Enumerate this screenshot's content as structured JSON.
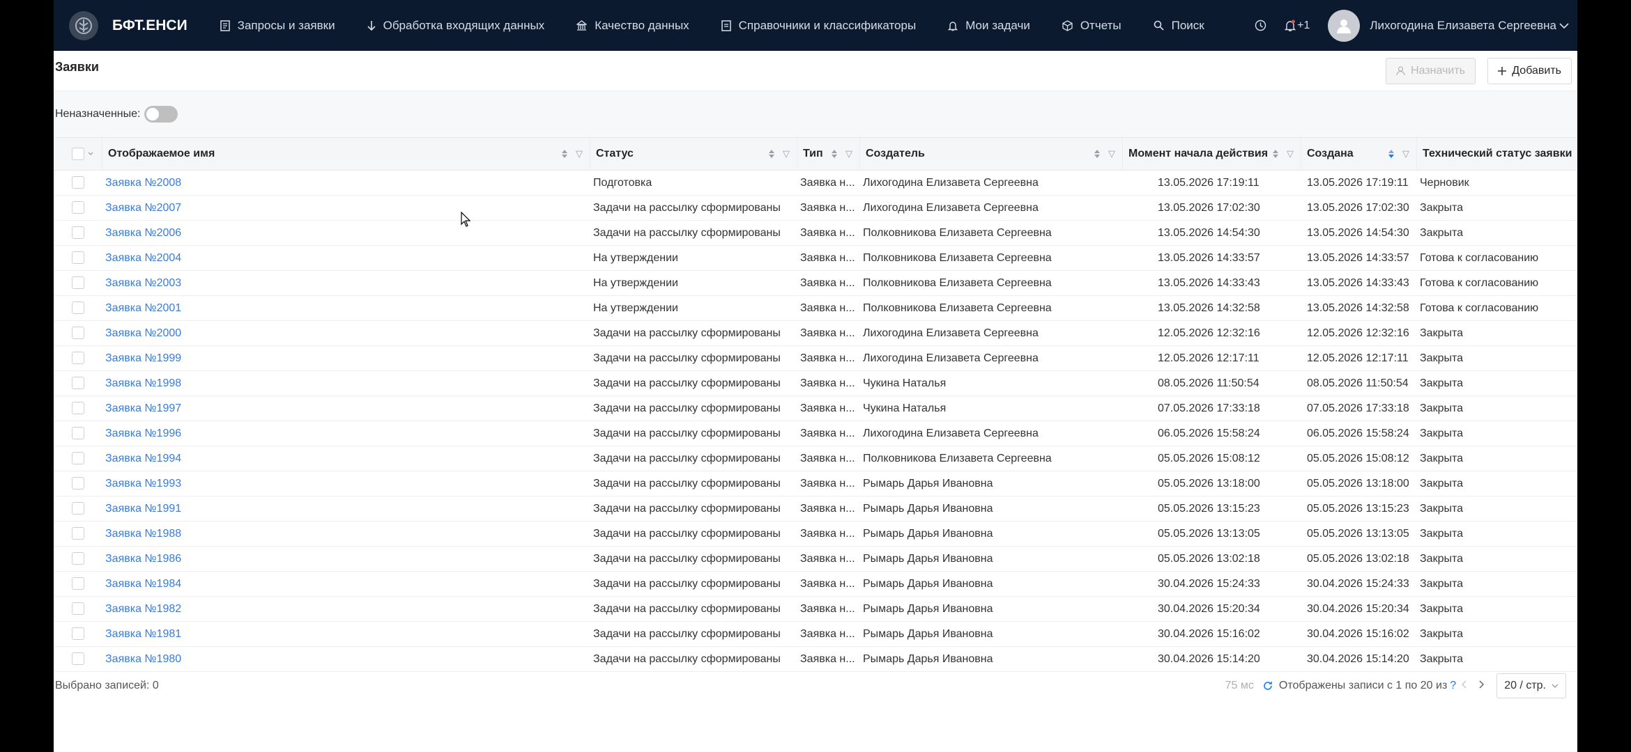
{
  "topbar": {
    "brand": "БФТ.ЕНСИ",
    "nav": [
      {
        "label": "Запросы и заявки",
        "icon": "document-icon"
      },
      {
        "label": "Обработка входящих данных",
        "icon": "arrow-down-icon"
      },
      {
        "label": "Качество данных",
        "icon": "bank-icon"
      },
      {
        "label": "Справочники и классификаторы",
        "icon": "book-icon"
      },
      {
        "label": "Мои задачи",
        "icon": "bell-icon"
      },
      {
        "label": "Отчеты",
        "icon": "cube-icon"
      },
      {
        "label": "Поиск",
        "icon": "search-icon"
      }
    ],
    "notifications": "+1",
    "user": "Лихогодина Елизавета Сергеевна"
  },
  "page": {
    "title": "Заявки",
    "assign_button": "Назначить",
    "add_button": "Добавить"
  },
  "filter": {
    "unassigned_label": "Неназначенные:",
    "unassigned_on": false
  },
  "table": {
    "columns": [
      "Отображаемое имя",
      "Статус",
      "Тип",
      "Создатель",
      "Момент начала действия",
      "Создана",
      "Технический статус заявки"
    ],
    "rows": [
      [
        "Заявка №2008",
        "Подготовка",
        "Заявка н...",
        "Лихогодина Елизавета Сергеевна",
        "13.05.2026 17:19:11",
        "13.05.2026 17:19:11",
        "Черновик"
      ],
      [
        "Заявка №2007",
        "Задачи на рассылку сформированы",
        "Заявка н...",
        "Лихогодина Елизавета Сергеевна",
        "13.05.2026 17:02:30",
        "13.05.2026 17:02:30",
        "Закрыта"
      ],
      [
        "Заявка №2006",
        "Задачи на рассылку сформированы",
        "Заявка н...",
        "Полковникова Елизавета Сергеевна",
        "13.05.2026 14:54:30",
        "13.05.2026 14:54:30",
        "Закрыта"
      ],
      [
        "Заявка №2004",
        "На утверждении",
        "Заявка н...",
        "Полковникова Елизавета Сергеевна",
        "13.05.2026 14:33:57",
        "13.05.2026 14:33:57",
        "Готова к согласованию"
      ],
      [
        "Заявка №2003",
        "На утверждении",
        "Заявка н...",
        "Полковникова Елизавета Сергеевна",
        "13.05.2026 14:33:43",
        "13.05.2026 14:33:43",
        "Готова к согласованию"
      ],
      [
        "Заявка №2001",
        "На утверждении",
        "Заявка н...",
        "Полковникова Елизавета Сергеевна",
        "13.05.2026 14:32:58",
        "13.05.2026 14:32:58",
        "Готова к согласованию"
      ],
      [
        "Заявка №2000",
        "Задачи на рассылку сформированы",
        "Заявка н...",
        "Лихогодина Елизавета Сергеевна",
        "12.05.2026 12:32:16",
        "12.05.2026 12:32:16",
        "Закрыта"
      ],
      [
        "Заявка №1999",
        "Задачи на рассылку сформированы",
        "Заявка н...",
        "Лихогодина Елизавета Сергеевна",
        "12.05.2026 12:17:11",
        "12.05.2026 12:17:11",
        "Закрыта"
      ],
      [
        "Заявка №1998",
        "Задачи на рассылку сформированы",
        "Заявка н...",
        "Чукина Наталья",
        "08.05.2026 11:50:54",
        "08.05.2026 11:50:54",
        "Закрыта"
      ],
      [
        "Заявка №1997",
        "Задачи на рассылку сформированы",
        "Заявка н...",
        "Чукина Наталья",
        "07.05.2026 17:33:18",
        "07.05.2026 17:33:18",
        "Закрыта"
      ],
      [
        "Заявка №1996",
        "Задачи на рассылку сформированы",
        "Заявка н...",
        "Лихогодина Елизавета Сергеевна",
        "06.05.2026 15:58:24",
        "06.05.2026 15:58:24",
        "Закрыта"
      ],
      [
        "Заявка №1994",
        "Задачи на рассылку сформированы",
        "Заявка н...",
        "Полковникова Елизавета Сергеевна",
        "05.05.2026 15:08:12",
        "05.05.2026 15:08:12",
        "Закрыта"
      ],
      [
        "Заявка №1993",
        "Задачи на рассылку сформированы",
        "Заявка н...",
        "Рымарь Дарья Ивановна",
        "05.05.2026 13:18:00",
        "05.05.2026 13:18:00",
        "Закрыта"
      ],
      [
        "Заявка №1991",
        "Задачи на рассылку сформированы",
        "Заявка н...",
        "Рымарь Дарья Ивановна",
        "05.05.2026 13:15:23",
        "05.05.2026 13:15:23",
        "Закрыта"
      ],
      [
        "Заявка №1988",
        "Задачи на рассылку сформированы",
        "Заявка н...",
        "Рымарь Дарья Ивановна",
        "05.05.2026 13:13:05",
        "05.05.2026 13:13:05",
        "Закрыта"
      ],
      [
        "Заявка №1986",
        "Задачи на рассылку сформированы",
        "Заявка н...",
        "Рымарь Дарья Ивановна",
        "05.05.2026 13:02:18",
        "05.05.2026 13:02:18",
        "Закрыта"
      ],
      [
        "Заявка №1984",
        "Задачи на рассылку сформированы",
        "Заявка н...",
        "Рымарь Дарья Ивановна",
        "30.04.2026 15:24:33",
        "30.04.2026 15:24:33",
        "Закрыта"
      ],
      [
        "Заявка №1982",
        "Задачи на рассылку сформированы",
        "Заявка н...",
        "Рымарь Дарья Ивановна",
        "30.04.2026 15:20:34",
        "30.04.2026 15:20:34",
        "Закрыта"
      ],
      [
        "Заявка №1981",
        "Задачи на рассылку сформированы",
        "Заявка н...",
        "Рымарь Дарья Ивановна",
        "30.04.2026 15:16:02",
        "30.04.2026 15:16:02",
        "Закрыта"
      ],
      [
        "Заявка №1980",
        "Задачи на рассылку сформированы",
        "Заявка н...",
        "Рымарь Дарья Ивановна",
        "30.04.2026 15:14:20",
        "30.04.2026 15:14:20",
        "Закрыта"
      ]
    ]
  },
  "footer": {
    "selected": "Выбрано записей: 0",
    "timing": "75 мс",
    "shown": "Отображены записи с 1 по 20 из",
    "total_unknown": "?",
    "page_size": "20 / стр."
  },
  "colors": {
    "topbar_bg": "#0b1a2e",
    "link": "#3a7bd5"
  }
}
